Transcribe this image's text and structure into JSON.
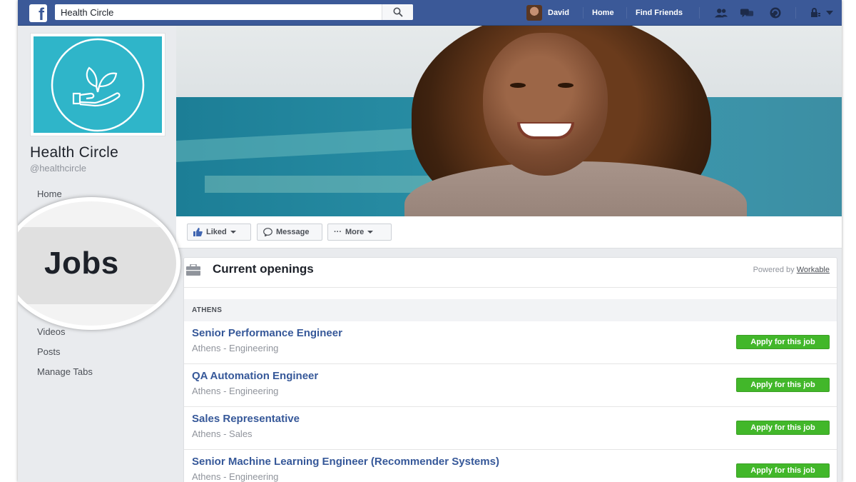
{
  "colors": {
    "fb_blue": "#3b5998",
    "link_blue": "#365899",
    "apply_green": "#42b72a",
    "profile_teal": "#2fb5c9"
  },
  "topbar": {
    "logo_letter": "f",
    "search_value": "Health Circle",
    "search_icon": "search-icon",
    "user_name": "David",
    "home": "Home",
    "find_friends": "Find Friends",
    "icons": [
      "friend-requests-icon",
      "messages-icon",
      "notifications-icon",
      "privacy-icon",
      "menu-caret-icon"
    ]
  },
  "page": {
    "name": "Health Circle",
    "handle": "@healthcircle",
    "logo_icon": "hand-with-leaves-icon"
  },
  "sidebar": {
    "home": "Home",
    "jobs": "Jobs",
    "videos": "Videos",
    "posts": "Posts",
    "manage_tabs": "Manage Tabs"
  },
  "actions": {
    "liked": "Liked",
    "message": "Message",
    "more": "More",
    "more_prefix": "···"
  },
  "jobs": {
    "title": "Current openings",
    "powered_by": "Powered by",
    "powered_link": "Workable",
    "location": "ATHENS",
    "apply_label": "Apply for this job",
    "list": [
      {
        "title": "Senior Performance Engineer",
        "meta": "Athens - Engineering"
      },
      {
        "title": "QA Automation Engineer",
        "meta": "Athens - Engineering"
      },
      {
        "title": "Sales Representative",
        "meta": "Athens - Sales"
      },
      {
        "title": "Senior Machine Learning Engineer (Recommender Systems)",
        "meta": "Athens - Engineering"
      }
    ]
  }
}
